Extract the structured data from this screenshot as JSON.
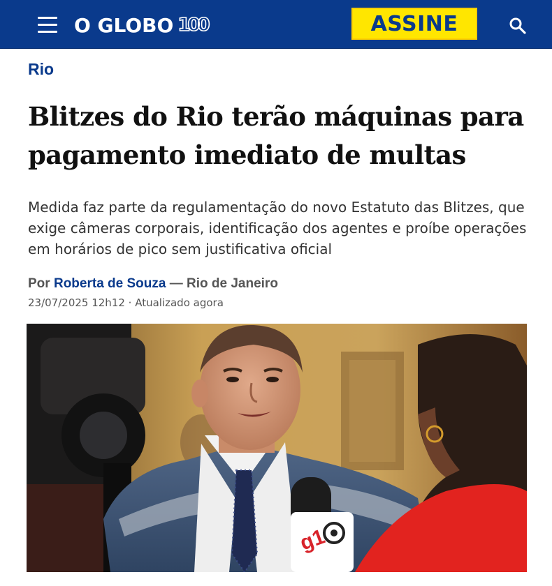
{
  "header": {
    "logo_text": "O GLOBO",
    "logo_hundred": "100",
    "subscribe_label": "ASSINE",
    "menu_icon": "hamburger-menu-icon",
    "search_icon": "search-icon",
    "brand_color": "#0a3a8c",
    "subscribe_color": "#ffe600"
  },
  "article": {
    "section": "Rio",
    "headline": "Blitzes do Rio terão máquinas para pagamento imediato de multas",
    "subtitle": "Medida faz parte da regulamentação do novo Estatuto das Blitzes, que exige câmeras corporais, identificação dos agentes e proíbe operações em horários de pico sem justificativa oficial",
    "byline_prefix": "Por",
    "author": "Roberta de Souza",
    "byline_suffix": "— Rio de Janeiro",
    "timestamp": "23/07/2025 12h12 · Atualizado agora",
    "mic_logo_text": "g1"
  }
}
